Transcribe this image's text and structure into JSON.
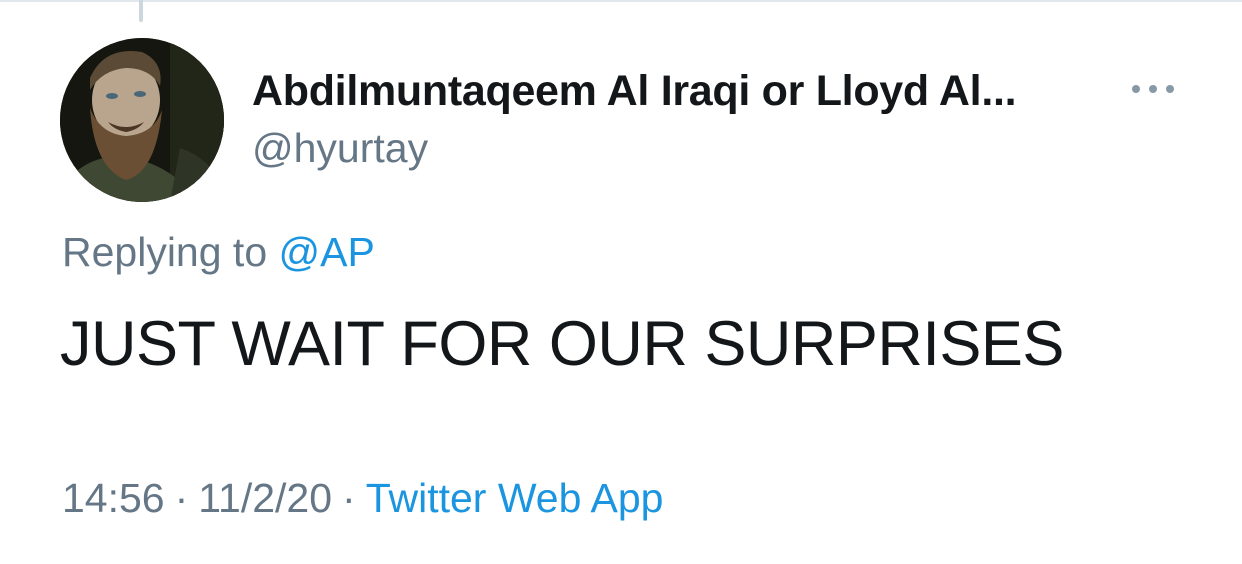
{
  "tweet": {
    "display_name": "Abdilmuntaqeem Al Iraqi or Lloyd Al...",
    "username": "@hyurtay",
    "replying_prefix": "Replying to",
    "replying_to": "@AP",
    "text": "JUST WAIT FOR OUR SURPRISES",
    "time": "14:56",
    "separator": "·",
    "date": "11/2/20",
    "source": "Twitter Web App"
  },
  "icons": {
    "more": "more-horizontal-icon"
  },
  "colors": {
    "text_primary": "#14171a",
    "text_secondary": "#657786",
    "link": "#1b95e0",
    "divider": "#e1e8ed"
  }
}
